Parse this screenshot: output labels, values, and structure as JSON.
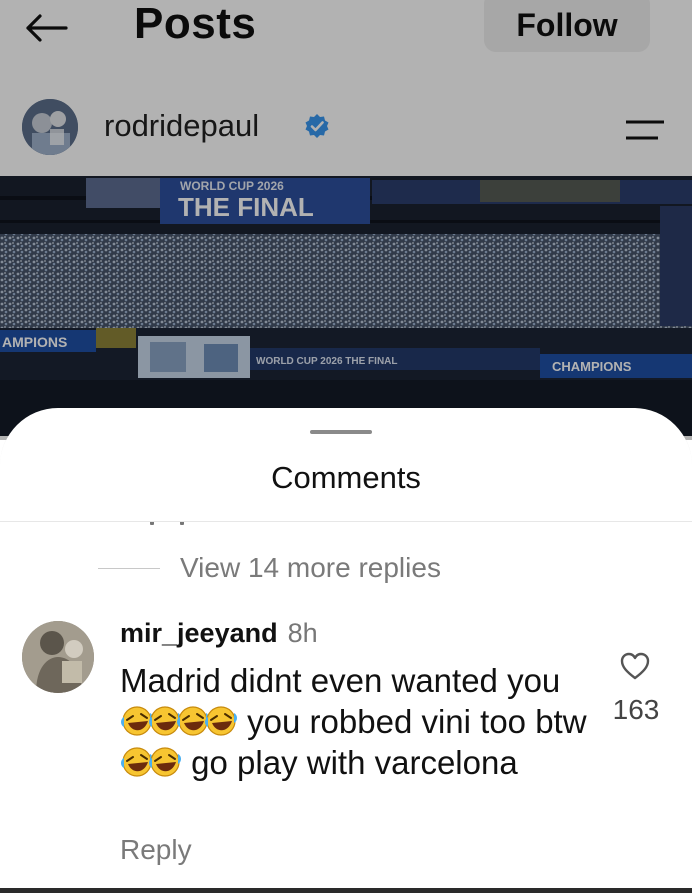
{
  "header": {
    "title": "Posts",
    "follow_label": "Follow"
  },
  "profile": {
    "username": "rodridepaul",
    "verified": true
  },
  "photo": {
    "banner_top_line": "WORLD CUP 2026",
    "banner_top_main": "THE FINAL",
    "banner_left": "AMPIONS",
    "banner_mid": "WORLD CUP 2026 THE FINAL",
    "banner_right": "CHAMPIONS"
  },
  "comments_sheet": {
    "title": "Comments",
    "view_more_replies": "View 14 more replies",
    "comment": {
      "username": "mir_jeeyand",
      "time": "8h",
      "text_part1": "Madrid didnt even wanted you",
      "text_part2": "you robbed vini too btw",
      "text_part3": "go play with varcelona",
      "emoji_group1": [
        "rolling-on-floor-laughing",
        "rolling-on-floor-laughing",
        "rolling-on-floor-laughing",
        "rolling-on-floor-laughing"
      ],
      "emoji_group2": [
        "rolling-on-floor-laughing",
        "rolling-on-floor-laughing"
      ],
      "likes": "163",
      "reply_label": "Reply"
    }
  },
  "colors": {
    "verified_blue": "#3897f0",
    "muted_text": "#7a7a7a",
    "follow_bg": "#efefef"
  }
}
